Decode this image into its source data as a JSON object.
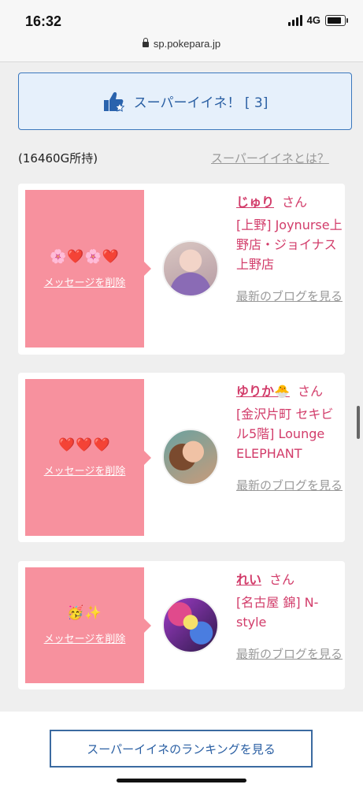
{
  "status": {
    "time": "16:32",
    "network": "4G",
    "url": "sp.pokepara.jp"
  },
  "super_iine": {
    "label": "スーパーイイネ！ [ 3]"
  },
  "points": {
    "text": "(16460G所持)"
  },
  "about_link": "スーパーイイネとは？",
  "cards": [
    {
      "message": "🌸❤️🌸❤️",
      "delete_label": "メッセージを削除",
      "name": "じゅり",
      "honorific": "さん",
      "shop": "[上野] Joynurse上野店・ジョイナス上野店",
      "blog_link": "最新のブログを見る"
    },
    {
      "message": "❤️❤️❤️",
      "delete_label": "メッセージを削除",
      "name": "ゆりか🐣",
      "honorific": "さん",
      "shop": "[金沢片町 セキビル5階] Lounge ELEPHANT",
      "blog_link": "最新のブログを見る"
    },
    {
      "message": "🥳✨",
      "delete_label": "メッセージを削除",
      "name": "れい",
      "honorific": "さん",
      "shop": "[名古屋 錦] N-style",
      "blog_link": "最新のブログを見る"
    }
  ],
  "ranking_button": "スーパーイイネのランキングを見る",
  "icons": {
    "thumb": "thumbs-up-icon",
    "lock": "lock-icon",
    "battery": "battery-icon",
    "signal": "signal-icon"
  },
  "colors": {
    "accent_blue": "#3b77bd",
    "pink": "#f7919e",
    "name_pink": "#d23c6a"
  }
}
